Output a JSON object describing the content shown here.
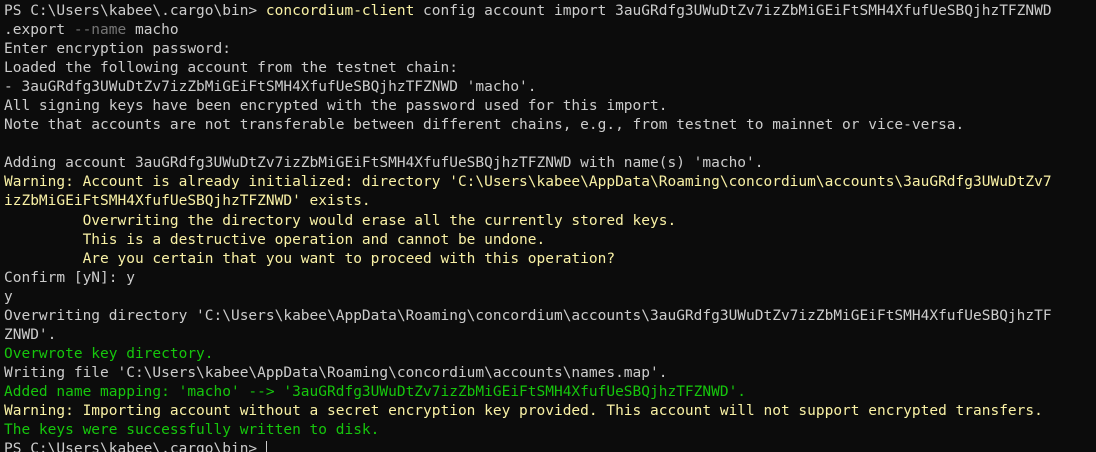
{
  "terminal": {
    "prompt": "PS C:\\Users\\kabee\\.cargo\\bin> ",
    "command": {
      "exe": "concordium-client",
      "args_part1": " config account import 3auGRdfg3UWuDtZv7izZbMiGEiFtSMH4XfufUeSBQjhzTFZNWD",
      "args_part2_a": ".export ",
      "flag": "--name",
      "args_part2_b": " macho"
    },
    "lines": [
      {
        "text": "Enter encryption password:",
        "color": "default"
      },
      {
        "text": "Loaded the following account from the testnet chain:",
        "color": "default"
      },
      {
        "text": "- 3auGRdfg3UWuDtZv7izZbMiGEiFtSMH4XfufUeSBQjhzTFZNWD 'macho'.",
        "color": "default"
      },
      {
        "text": "All signing keys have been encrypted with the password used for this import.",
        "color": "default"
      },
      {
        "text": "Note that accounts are not transferable between different chains, e.g., from testnet to mainnet or vice-versa.",
        "color": "default"
      },
      {
        "text": "",
        "color": "default"
      },
      {
        "text": "Adding account 3auGRdfg3UWuDtZv7izZbMiGEiFtSMH4XfufUeSBQjhzTFZNWD with name(s) 'macho'.",
        "color": "default"
      },
      {
        "text": "Warning: Account is already initialized: directory 'C:\\Users\\kabee\\AppData\\Roaming\\concordium\\accounts\\3auGRdfg3UWuDtZv7",
        "color": "yellow"
      },
      {
        "text": "izZbMiGEiFtSMH4XfufUeSBQjhzTFZNWD' exists.",
        "color": "yellow"
      },
      {
        "text": "         Overwriting the directory would erase all the currently stored keys.",
        "color": "yellow"
      },
      {
        "text": "         This is a destructive operation and cannot be undone.",
        "color": "yellow"
      },
      {
        "text": "         Are you certain that you want to proceed with this operation?",
        "color": "yellow"
      },
      {
        "text": "Confirm [yN]: y",
        "color": "default"
      },
      {
        "text": "y",
        "color": "default"
      },
      {
        "text": "Overwriting directory 'C:\\Users\\kabee\\AppData\\Roaming\\concordium\\accounts\\3auGRdfg3UWuDtZv7izZbMiGEiFtSMH4XfufUeSBQjhzTF",
        "color": "default"
      },
      {
        "text": "ZNWD'.",
        "color": "default"
      },
      {
        "text": "Overwrote key directory.",
        "color": "green"
      },
      {
        "text": "Writing file 'C:\\Users\\kabee\\AppData\\Roaming\\concordium\\accounts\\names.map'.",
        "color": "default"
      },
      {
        "text": "Added name mapping: 'macho' --> '3auGRdfg3UWuDtZv7izZbMiGEiFtSMH4XfufUeSBQjhzTFZNWD'.",
        "color": "green"
      },
      {
        "text": "Warning: Importing account without a secret encryption key provided. This account will not support encrypted transfers.",
        "color": "yellow"
      },
      {
        "text": "The keys were successfully written to disk.",
        "color": "green"
      }
    ],
    "final_prompt": "PS C:\\Users\\kabee\\.cargo\\bin> ",
    "colors": {
      "background": "#0c0c0c",
      "default": "#cccccc",
      "yellow": "#f9f1a5",
      "green": "#16c60c",
      "flag": "#767676"
    }
  }
}
